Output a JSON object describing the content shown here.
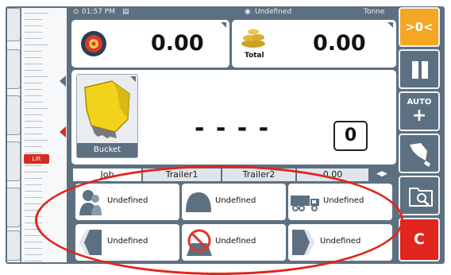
{
  "status_bar": {
    "time": "01:57 PM",
    "material": "Undefined",
    "unit": "Tonne"
  },
  "weights": {
    "current": "0.00",
    "total": "0.00",
    "total_label": "Total"
  },
  "attachment": {
    "name": "Bucket",
    "dashes": "- - - -",
    "count": "0"
  },
  "side": {
    "lift_label": "Lift"
  },
  "tabs": [
    "Job",
    "Trailer1",
    "Trailer2",
    "0.00"
  ],
  "grid": [
    {
      "label": "Undefined",
      "icon": "person-icon"
    },
    {
      "label": "Undefined",
      "icon": "dome-icon"
    },
    {
      "label": "Undefined",
      "icon": "truck-icon"
    },
    {
      "label": "Undefined",
      "icon": "arrow-left-icon"
    },
    {
      "label": "Undefined",
      "icon": "no-steering-icon"
    },
    {
      "label": "Undefined",
      "icon": "arrow-right-icon"
    }
  ],
  "right_buttons": {
    "zero": ">0<",
    "auto_plus": "AUTO",
    "auto_plus_sign": "+",
    "cancel": "C"
  },
  "colors": {
    "frame": "#5d7081",
    "zero": "#f5a623",
    "cancel": "#e0261e",
    "annotation": "#e0261e"
  }
}
